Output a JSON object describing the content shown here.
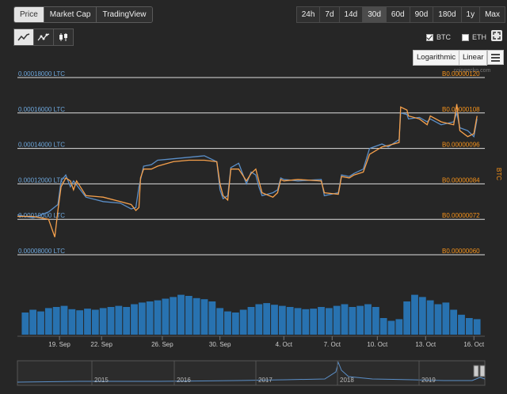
{
  "tabs": [
    "Price",
    "Market Cap",
    "TradingView"
  ],
  "active_tab": "Price",
  "ranges": [
    "24h",
    "7d",
    "14d",
    "30d",
    "60d",
    "90d",
    "180d",
    "1y",
    "Max"
  ],
  "active_range": "30d",
  "chart_type_buttons": [
    "line-chart-icon",
    "line-markers-chart-icon",
    "candlestick-icon"
  ],
  "toggles": {
    "btc": "BTC",
    "btc_checked": true,
    "eth": "ETH",
    "eth_checked": false
  },
  "scale_buttons": {
    "log": "Logarithmic",
    "linear": "Linear"
  },
  "watermark": "coingecko.com",
  "colors": {
    "btc_line": "#f7a14c",
    "ltc_line": "#5b8fc8",
    "volume": "#2872b0",
    "left_axis_text": "#6ea8de",
    "right_axis_text": "#f7931a",
    "grid": "#dddddd"
  },
  "chart_data": {
    "type": "line",
    "x_ticks": [
      "19. Sep",
      "22. Sep",
      "26. Sep",
      "30. Sep",
      "4. Oct",
      "7. Oct",
      "10. Oct",
      "13. Oct",
      "16. Oct"
    ],
    "x_tick_days": [
      2.7,
      5.4,
      9.3,
      13.0,
      17.1,
      20.2,
      23.1,
      26.2,
      29.3
    ],
    "x_range_days": [
      0,
      30
    ],
    "left_axis": {
      "ticks": [
        "0.00008000 LTC",
        "0.00010000 LTC",
        "0.00012000 LTC",
        "0.00014000 LTC",
        "0.00016000 LTC",
        "0.00018000 LTC"
      ],
      "values": [
        8e-05,
        0.0001,
        0.00012,
        0.00014,
        0.00016,
        0.00018
      ]
    },
    "right_axis": {
      "ticks": [
        "B0.00000060",
        "B0.00000072",
        "B0.00000084",
        "B0.00000096",
        "B0.00000108",
        "B0.00000120"
      ],
      "values": [
        6e-07,
        7.2e-07,
        8.4e-07,
        9.6e-07,
        1.08e-06,
        1.2e-06
      ],
      "label": "BTC"
    },
    "ylim_btc": [
      6e-07,
      1.2e-06
    ],
    "series": [
      {
        "axis": "right",
        "points": [
          [
            0,
            7.3e-07
          ],
          [
            1,
            7.3e-07
          ],
          [
            2,
            7.2e-07
          ],
          [
            2.4,
            6.6e-07
          ],
          [
            2.6,
            7.5e-07
          ],
          [
            2.8,
            8.3e-07
          ],
          [
            3.1,
            8.6e-07
          ],
          [
            3.4,
            8.5e-07
          ],
          [
            3.6,
            8.2e-07
          ],
          [
            3.8,
            8.5e-07
          ],
          [
            4.4,
            8e-07
          ],
          [
            5.5,
            7.95e-07
          ],
          [
            6.6,
            7.8e-07
          ],
          [
            7.3,
            7.7e-07
          ],
          [
            7.6,
            7.5e-07
          ],
          [
            7.8,
            7.6e-07
          ],
          [
            7.9,
            8.6e-07
          ],
          [
            8.1,
            8.9e-07
          ],
          [
            8.6,
            8.9e-07
          ],
          [
            9.0,
            9e-07
          ],
          [
            10.0,
            9.15e-07
          ],
          [
            11,
            9.2e-07
          ],
          [
            12,
            9.2e-07
          ],
          [
            12.8,
            9.15e-07
          ],
          [
            13.0,
            8.4e-07
          ],
          [
            13.2,
            8e-07
          ],
          [
            13.5,
            7.85e-07
          ],
          [
            13.7,
            8.9e-07
          ],
          [
            14.2,
            8.9e-07
          ],
          [
            14.7,
            8.5e-07
          ],
          [
            15.0,
            8.75e-07
          ],
          [
            15.3,
            8.9e-07
          ],
          [
            15.5,
            8.5e-07
          ],
          [
            15.7,
            8.1e-07
          ],
          [
            16.4,
            7.95e-07
          ],
          [
            16.7,
            8.1e-07
          ],
          [
            16.9,
            8.55e-07
          ],
          [
            17.1,
            8.5e-07
          ],
          [
            18,
            8.55e-07
          ],
          [
            19.5,
            8.5e-07
          ],
          [
            19.7,
            8.1e-07
          ],
          [
            20.6,
            8.05e-07
          ],
          [
            20.8,
            8.65e-07
          ],
          [
            21.3,
            8.6e-07
          ],
          [
            21.6,
            8.7e-07
          ],
          [
            22.2,
            8.8e-07
          ],
          [
            22.6,
            9.4e-07
          ],
          [
            23.4,
            9.65e-07
          ],
          [
            23.8,
            9.7e-07
          ],
          [
            24.5,
            9.8e-07
          ],
          [
            24.6,
            1.1e-06
          ],
          [
            25.0,
            1.09e-06
          ],
          [
            25.1,
            1.07e-06
          ],
          [
            25.8,
            1.06e-06
          ],
          [
            26.3,
            1.04e-06
          ],
          [
            26.5,
            1.07e-06
          ],
          [
            27.2,
            1.05e-06
          ],
          [
            28.0,
            1.04e-06
          ],
          [
            28.2,
            1.11e-06
          ],
          [
            28.4,
            1.02e-06
          ],
          [
            28.9,
            1e-06
          ],
          [
            29.3,
            1.01e-06
          ],
          [
            29.5,
            1.07e-06
          ]
        ],
        "color": "#f7a14c"
      },
      {
        "axis": "right",
        "points": [
          [
            0,
            7.35e-07
          ],
          [
            1,
            7.25e-07
          ],
          [
            2,
            7.45e-07
          ],
          [
            2.6,
            7.7e-07
          ],
          [
            2.8,
            8.5e-07
          ],
          [
            3.1,
            8.7e-07
          ],
          [
            3.4,
            8.3e-07
          ],
          [
            3.6,
            8.5e-07
          ],
          [
            4.4,
            7.95e-07
          ],
          [
            5.5,
            7.8e-07
          ],
          [
            6.6,
            7.75e-07
          ],
          [
            7.3,
            7.55e-07
          ],
          [
            7.6,
            7.6e-07
          ],
          [
            7.8,
            8.3e-07
          ],
          [
            8.1,
            9e-07
          ],
          [
            8.6,
            9.05e-07
          ],
          [
            9.0,
            9.2e-07
          ],
          [
            10.0,
            9.25e-07
          ],
          [
            11,
            9.3e-07
          ],
          [
            12,
            9.35e-07
          ],
          [
            12.8,
            9.15e-07
          ],
          [
            13.0,
            8.2e-07
          ],
          [
            13.2,
            7.9e-07
          ],
          [
            13.5,
            8e-07
          ],
          [
            13.7,
            8.95e-07
          ],
          [
            14.2,
            9.1e-07
          ],
          [
            14.7,
            8.4e-07
          ],
          [
            15.0,
            8.8e-07
          ],
          [
            15.3,
            8.7e-07
          ],
          [
            15.5,
            8.3e-07
          ],
          [
            15.7,
            8e-07
          ],
          [
            16.4,
            8.1e-07
          ],
          [
            16.7,
            8.2e-07
          ],
          [
            16.9,
            8.6e-07
          ],
          [
            17.1,
            8.55e-07
          ],
          [
            18,
            8.5e-07
          ],
          [
            19.5,
            8.55e-07
          ],
          [
            19.7,
            8e-07
          ],
          [
            20.6,
            8.1e-07
          ],
          [
            20.8,
            8.7e-07
          ],
          [
            21.3,
            8.65e-07
          ],
          [
            21.6,
            8.75e-07
          ],
          [
            22.2,
            8.9e-07
          ],
          [
            22.6,
            9.6e-07
          ],
          [
            23.4,
            9.75e-07
          ],
          [
            23.8,
            9.65e-07
          ],
          [
            24.5,
            9.9e-07
          ],
          [
            24.6,
            1.08e-06
          ],
          [
            25.0,
            1.075e-06
          ],
          [
            25.1,
            1.06e-06
          ],
          [
            25.8,
            1.065e-06
          ],
          [
            26.3,
            1.05e-06
          ],
          [
            26.5,
            1.06e-06
          ],
          [
            27.2,
            1.04e-06
          ],
          [
            28.0,
            1.05e-06
          ],
          [
            28.2,
            1.08e-06
          ],
          [
            28.4,
            1.03e-06
          ],
          [
            28.9,
            1.02e-06
          ],
          [
            29.3,
            1e-06
          ],
          [
            29.5,
            1.06e-06
          ]
        ],
        "color": "#5b8fc8"
      }
    ],
    "volume": [
      [
        0.5,
        40
      ],
      [
        1.0,
        45
      ],
      [
        1.5,
        42
      ],
      [
        2.0,
        48
      ],
      [
        2.5,
        50
      ],
      [
        3.0,
        52
      ],
      [
        3.5,
        46
      ],
      [
        4.0,
        44
      ],
      [
        4.5,
        47
      ],
      [
        5.0,
        45
      ],
      [
        5.5,
        48
      ],
      [
        6.0,
        50
      ],
      [
        6.5,
        52
      ],
      [
        7.0,
        50
      ],
      [
        7.5,
        55
      ],
      [
        8.0,
        58
      ],
      [
        8.5,
        60
      ],
      [
        9.0,
        62
      ],
      [
        9.5,
        65
      ],
      [
        10.0,
        68
      ],
      [
        10.5,
        72
      ],
      [
        11.0,
        70
      ],
      [
        11.5,
        66
      ],
      [
        12.0,
        64
      ],
      [
        12.5,
        60
      ],
      [
        13.0,
        48
      ],
      [
        13.5,
        42
      ],
      [
        14.0,
        40
      ],
      [
        14.5,
        45
      ],
      [
        15.0,
        50
      ],
      [
        15.5,
        55
      ],
      [
        16.0,
        57
      ],
      [
        16.5,
        54
      ],
      [
        17.0,
        52
      ],
      [
        17.5,
        50
      ],
      [
        18.0,
        48
      ],
      [
        18.5,
        46
      ],
      [
        19.0,
        47
      ],
      [
        19.5,
        50
      ],
      [
        20.0,
        48
      ],
      [
        20.5,
        52
      ],
      [
        21.0,
        55
      ],
      [
        21.5,
        50
      ],
      [
        22.0,
        52
      ],
      [
        22.5,
        55
      ],
      [
        23.0,
        50
      ],
      [
        23.5,
        30
      ],
      [
        24.0,
        25
      ],
      [
        24.5,
        28
      ],
      [
        25.0,
        60
      ],
      [
        25.5,
        72
      ],
      [
        26.0,
        68
      ],
      [
        26.5,
        62
      ],
      [
        27.0,
        55
      ],
      [
        27.5,
        58
      ],
      [
        28.0,
        45
      ],
      [
        28.5,
        36
      ],
      [
        29.0,
        30
      ],
      [
        29.5,
        28
      ]
    ],
    "navigator": {
      "labels": [
        "2015",
        "2016",
        "2017",
        "2018",
        "2019"
      ]
    }
  }
}
